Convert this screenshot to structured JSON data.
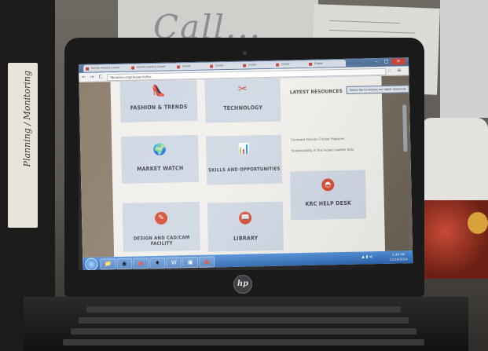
{
  "background": {
    "whiteboard_text": "Call...",
    "binder_text": "Planning / Monitoring"
  },
  "laptop": {
    "brand": "hp"
  },
  "browser": {
    "tabs": [
      {
        "label": "Fashion Industry Cluster"
      },
      {
        "label": "Fashion Industry Cluster"
      },
      {
        "label": "Cluster"
      },
      {
        "label": "Cluster"
      },
      {
        "label": "Cluster"
      },
      {
        "label": "Cluster"
      },
      {
        "label": "Cluster"
      }
    ],
    "url": "fibnation.org/research/itsc",
    "back_glyph": "←",
    "forward_glyph": "→",
    "reload_glyph": "C",
    "star_glyph": "☆",
    "menu_glyph": "≡",
    "window_controls": {
      "minimize": "–",
      "maximize": "□",
      "close": "×"
    }
  },
  "page": {
    "tiles": [
      {
        "label": "FASHION & TRENDS",
        "icon": "shoe-icon",
        "glyph": "👠"
      },
      {
        "label": "TECHNOLOGY",
        "icon": "tools-icon",
        "glyph": "✂"
      },
      {
        "label": "MARKET WATCH",
        "icon": "globe-icon",
        "glyph": "🌍"
      },
      {
        "label": "SKILLS AND OPPORTUNITIES",
        "icon": "worker-chart-icon",
        "glyph": "📊"
      },
      {
        "label": "DESIGN AND CAD/CAM FACILITY",
        "icon": "design-icon",
        "glyph": "✎"
      },
      {
        "label": "LIBRARY",
        "icon": "book-icon",
        "glyph": "📖"
      },
      {
        "label": "KRC HELP DESK",
        "icon": "helpdesk-icon",
        "glyph": "◓"
      }
    ],
    "latest_resources": {
      "title": "LATEST RESOURCES",
      "button": "Subscribe to receive our latest resources",
      "links": [
        "Compare Fashion Cluster Features",
        "Sustainability in the Indian Leather Indu"
      ]
    },
    "accent_color": "#d5462f",
    "tile_color": "#cdd6e2"
  },
  "taskbar": {
    "items": [
      "📁",
      "◉",
      "●",
      "♦",
      "W",
      "▣",
      "●"
    ],
    "tray": "▲ ▮ ◂)",
    "time": "1:46 PM",
    "date": "12/16/2014"
  }
}
